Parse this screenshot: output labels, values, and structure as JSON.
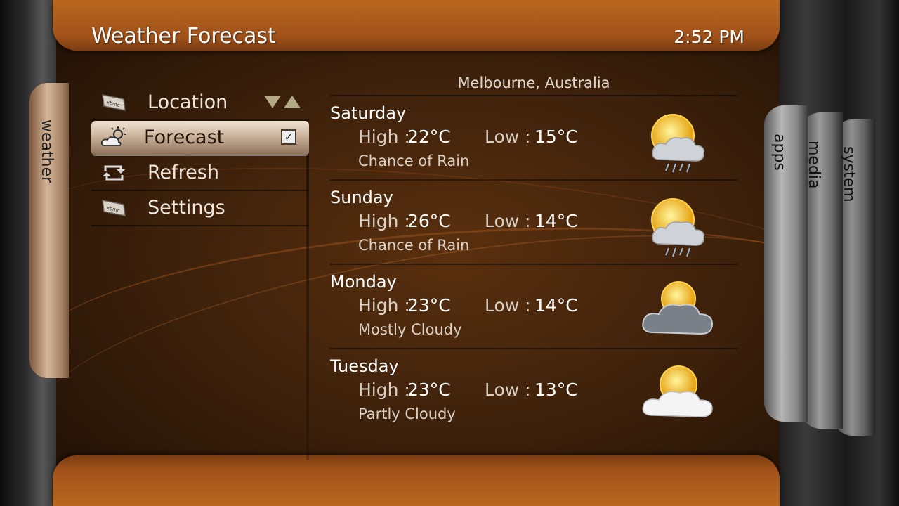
{
  "header": {
    "title": "Weather Forecast",
    "time": "2:52 PM"
  },
  "side_tab": {
    "label": "weather"
  },
  "right_tabs": [
    {
      "label": "apps"
    },
    {
      "label": "media"
    },
    {
      "label": "system"
    }
  ],
  "menu": {
    "items": [
      {
        "label": "Location",
        "icon": "xbmc-logo-icon",
        "control": "spinner"
      },
      {
        "label": "Forecast",
        "icon": "partly-cloudy-icon",
        "control": "checkbox",
        "selected": true,
        "checked": true
      },
      {
        "label": "Refresh",
        "icon": "refresh-icon"
      },
      {
        "label": "Settings",
        "icon": "xbmc-logo-icon"
      }
    ]
  },
  "location": "Melbourne, Australia",
  "forecast": [
    {
      "day": "Saturday",
      "high_label": "High :",
      "high": "22°C",
      "low_label": "Low :",
      "low": "15°C",
      "condition": "Chance of Rain",
      "icon": "sun-cloud-rain-icon"
    },
    {
      "day": "Sunday",
      "high_label": "High :",
      "high": "26°C",
      "low_label": "Low :",
      "low": "14°C",
      "condition": "Chance of Rain",
      "icon": "sun-cloud-rain-icon"
    },
    {
      "day": "Monday",
      "high_label": "High :",
      "high": "23°C",
      "low_label": "Low :",
      "low": "14°C",
      "condition": "Mostly Cloudy",
      "icon": "mostly-cloudy-icon"
    },
    {
      "day": "Tuesday",
      "high_label": "High :",
      "high": "23°C",
      "low_label": "Low :",
      "low": "13°C",
      "condition": "Partly Cloudy",
      "icon": "partly-cloudy-icon"
    }
  ],
  "colors": {
    "accent": "#a3531a",
    "background": "#3a1f0a",
    "text": "#e9e2da"
  }
}
